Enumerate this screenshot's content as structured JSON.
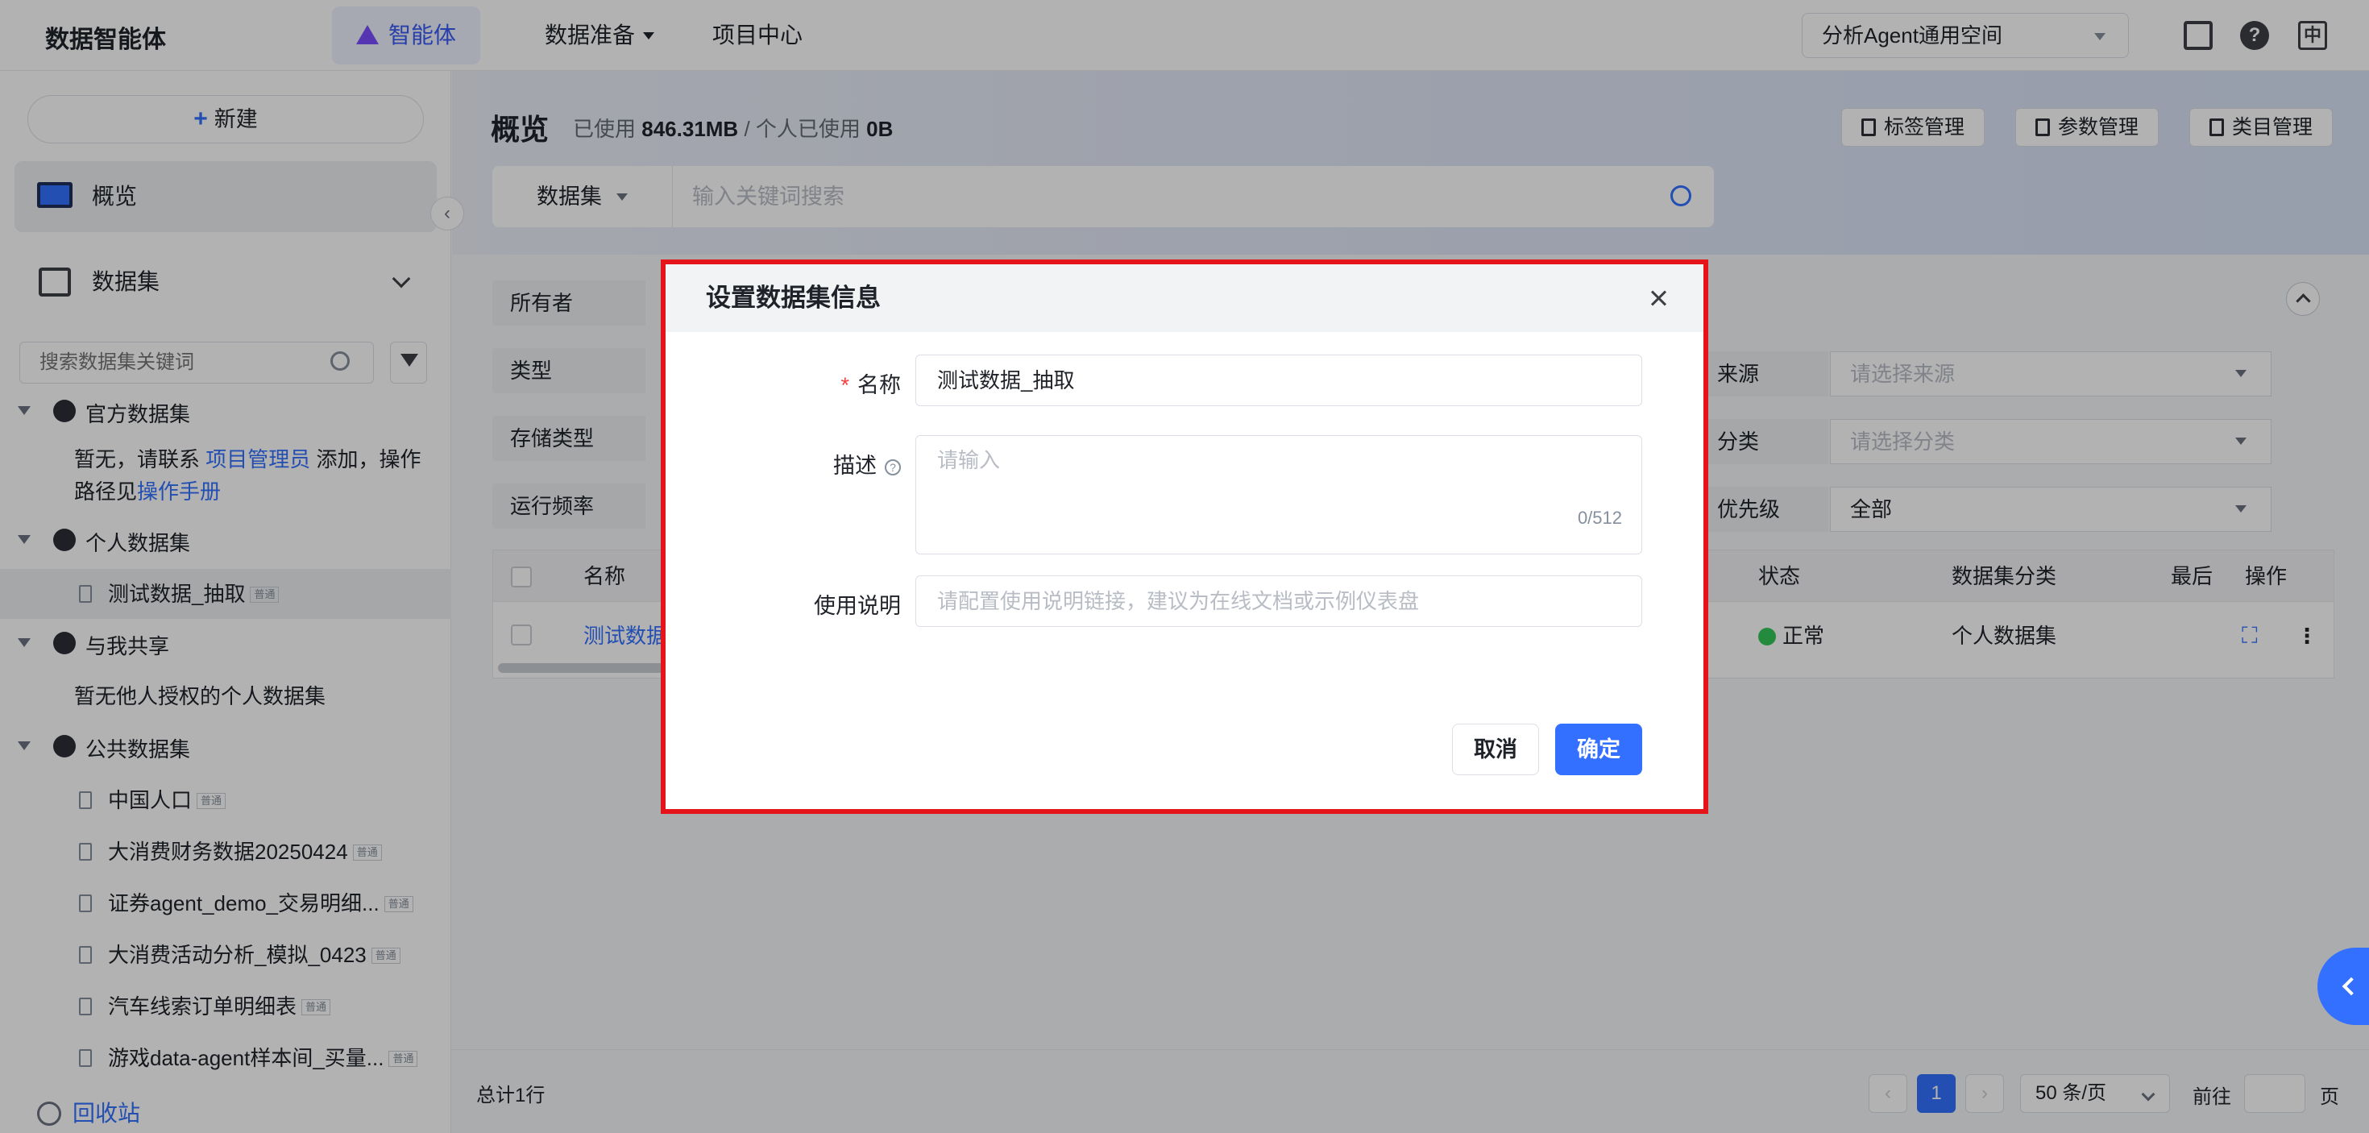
{
  "topnav": {
    "brand": "数据智能体",
    "items": [
      {
        "label": "智能体"
      },
      {
        "label": "数据准备"
      },
      {
        "label": "项目中心"
      }
    ],
    "space": "分析Agent通用空间",
    "lang_label": "中"
  },
  "sidebar": {
    "new_label": "新建",
    "overview_label": "概览",
    "dataset_label": "数据集",
    "search_placeholder": "搜索数据集关键词",
    "groups": {
      "official": {
        "label": "官方数据集",
        "note_pre": "暂无，请联系",
        "note_link1": "项目管理员",
        "note_mid": "添加，操作路径见",
        "note_link2": "操作手册"
      },
      "personal": {
        "label": "个人数据集",
        "items": [
          "测试数据_抽取"
        ]
      },
      "shared": {
        "label": "与我共享",
        "note": "暂无他人授权的个人数据集"
      },
      "public": {
        "label": "公共数据集",
        "items": [
          "中国人口",
          "大消费财务数据20250424",
          "证券agent_demo_交易明细...",
          "大消费活动分析_模拟_0423",
          "汽车线索订单明细表",
          "游戏data-agent样本间_买量..."
        ]
      }
    },
    "tag_label": "普通",
    "recycle_label": "回收站"
  },
  "main": {
    "title": "概览",
    "usage_prefix": "已使用",
    "usage_total": "846.31MB",
    "usage_sep": "/",
    "usage_personal_prefix": "个人已使用",
    "usage_personal": "0B",
    "buttons": {
      "tags": "标签管理",
      "params": "参数管理",
      "category": "类目管理"
    },
    "search": {
      "type": "数据集",
      "placeholder": "输入关键词搜索"
    },
    "filters": {
      "owner": "所有者",
      "type": "类型",
      "storage": "存储类型",
      "frequency": "运行频率",
      "source": "来源",
      "source_placeholder": "请选择来源",
      "category": "分类",
      "category_placeholder": "请选择分类",
      "priority": "优先级",
      "priority_value": "全部"
    },
    "table": {
      "headers": {
        "name": "名称",
        "status": "状态",
        "category": "数据集分类",
        "last": "最后",
        "ops": "操作"
      },
      "row": {
        "name": "测试数据",
        "status": "正常",
        "category": "个人数据集"
      }
    },
    "footer": {
      "total": "总计1行",
      "current_page": "1",
      "page_size": "50 条/页",
      "goto": "前往",
      "page": "页"
    }
  },
  "dialog": {
    "title": "设置数据集信息",
    "name_label": "名称",
    "name_value": "测试数据_抽取",
    "desc_label": "描述",
    "desc_placeholder": "请输入",
    "desc_count": "0/512",
    "usage_label": "使用说明",
    "usage_placeholder": "请配置使用说明链接，建议为在线文档或示例仪表盘",
    "cancel": "取消",
    "confirm": "确定"
  }
}
